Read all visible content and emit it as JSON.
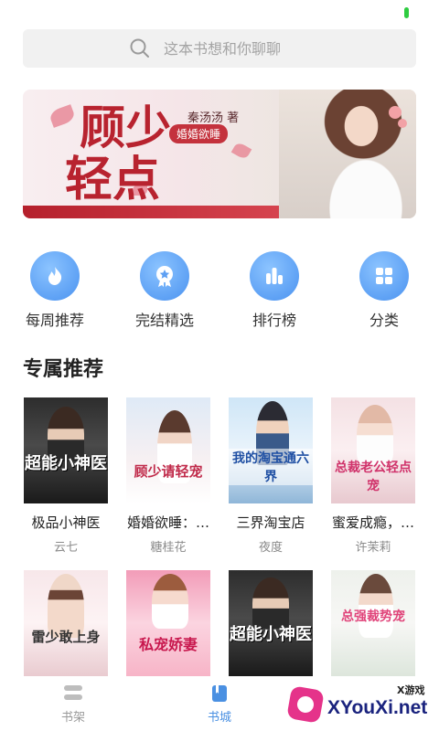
{
  "search": {
    "placeholder": "这本书想和你聊聊"
  },
  "banner": {
    "title_line1": "顾少",
    "title_line2": "轻点",
    "author": "秦汤汤 著",
    "subtitle": "婚婚欲睡"
  },
  "quick_nav": [
    {
      "label": "每周推荐",
      "icon": "flame-icon"
    },
    {
      "label": "完结精选",
      "icon": "star-badge-icon"
    },
    {
      "label": "排行榜",
      "icon": "bar-chart-icon"
    },
    {
      "label": "分类",
      "icon": "grid-icon"
    }
  ],
  "section": {
    "title": "专属推荐"
  },
  "books_row1": [
    {
      "name": "极品小神医",
      "author": "云七",
      "cover_title": "超能小神医"
    },
    {
      "name": "婚婚欲睡：…",
      "author": "糖桂花",
      "cover_title": "顾少请轻宠"
    },
    {
      "name": "三界淘宝店",
      "author": "夜度",
      "cover_title": "我的淘宝通六界"
    },
    {
      "name": "蜜爱成瘾，…",
      "author": "许茉莉",
      "cover_title": "总裁老公轻点宠"
    }
  ],
  "books_row2": [
    {
      "cover_title": "雷少敢上身"
    },
    {
      "cover_title": "私宠娇妻"
    },
    {
      "cover_title": "超能小神医"
    },
    {
      "cover_title": "总强裁势宠"
    }
  ],
  "bottom_nav": [
    {
      "label": "书架",
      "icon": "bookshelf-icon",
      "active": false
    },
    {
      "label": "书城",
      "icon": "book-icon",
      "active": true
    }
  ],
  "watermark": {
    "small": "X游戏",
    "big": "XYouXi.net"
  },
  "colors": {
    "accent": "#4a90e2",
    "banner_red": "#b8232f"
  }
}
